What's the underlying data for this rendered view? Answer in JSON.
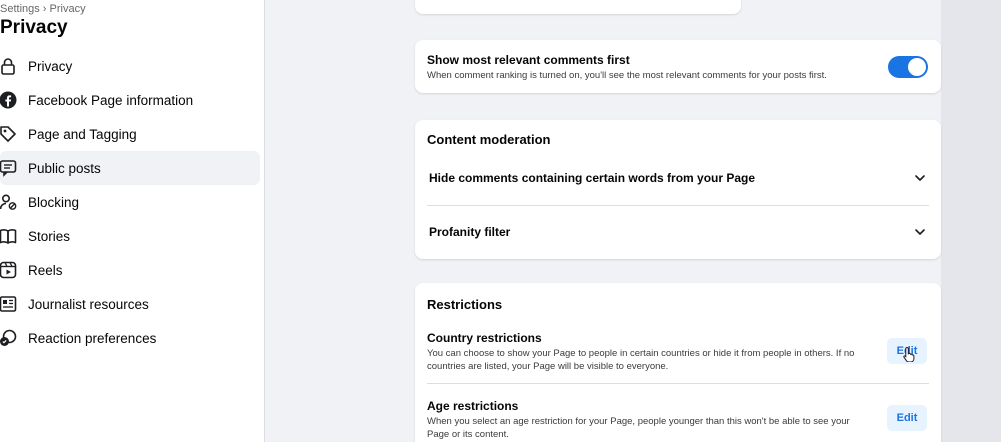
{
  "sidebar": {
    "breadcrumb": "Settings › Privacy",
    "title": "Privacy",
    "items": [
      {
        "label": "Privacy",
        "icon": "lock-icon"
      },
      {
        "label": "Facebook Page information",
        "icon": "facebook-icon"
      },
      {
        "label": "Page and Tagging",
        "icon": "tag-icon"
      },
      {
        "label": "Public posts",
        "icon": "public-posts-icon",
        "active": true
      },
      {
        "label": "Blocking",
        "icon": "blocking-icon"
      },
      {
        "label": "Stories",
        "icon": "book-icon"
      },
      {
        "label": "Reels",
        "icon": "reels-icon"
      },
      {
        "label": "Journalist resources",
        "icon": "newspaper-icon"
      },
      {
        "label": "Reaction preferences",
        "icon": "reaction-icon"
      }
    ]
  },
  "comments_setting": {
    "title": "Show most relevant comments first",
    "description": "When comment ranking is turned on, you'll see the most relevant comments for your posts first.",
    "enabled": true
  },
  "content_moderation": {
    "title": "Content moderation",
    "rows": [
      {
        "label": "Hide comments containing certain words from your Page"
      },
      {
        "label": "Profanity filter"
      }
    ]
  },
  "restrictions": {
    "title": "Restrictions",
    "country": {
      "title": "Country restrictions",
      "description": "You can choose to show your Page to people in certain countries or hide it from people in others. If no countries are listed, your Page will be visible to everyone.",
      "button": "Edit"
    },
    "age": {
      "title": "Age restrictions",
      "description": "When you select an age restriction for your Page, people younger than this won't be able to see your Page or its content.",
      "button": "Edit"
    }
  },
  "colors": {
    "accent": "#1b74e4",
    "background": "#f0f2f5",
    "card": "#ffffff"
  }
}
